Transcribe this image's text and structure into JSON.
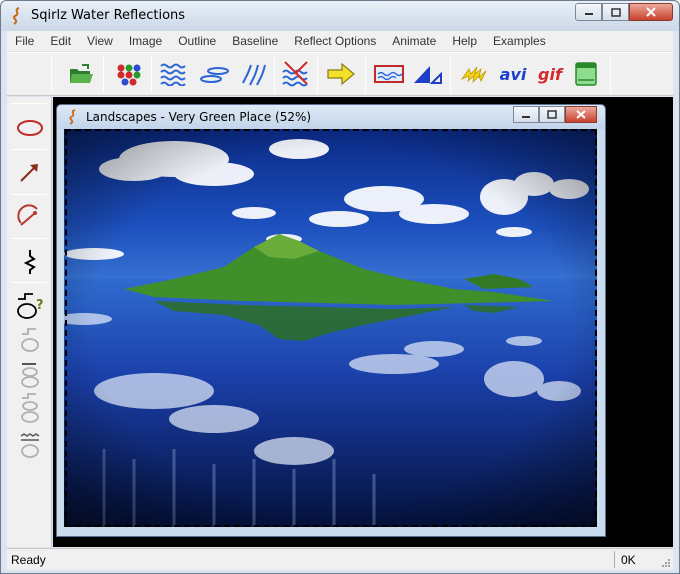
{
  "app": {
    "title": "Sqirlz Water Reflections",
    "logo_icon": "sqirlz-logo-icon"
  },
  "menu": [
    "File",
    "Edit",
    "View",
    "Image",
    "Outline",
    "Baseline",
    "Reflect Options",
    "Animate",
    "Help",
    "Examples"
  ],
  "toolbar": {
    "icons": [
      "open-folder-icon",
      "color-dots-icon",
      "wave-lines-icon",
      "ripple-ellipses-icon",
      "diagonal-waves-icon",
      "wave-cancel-icon",
      "arrow-right-icon",
      "reflect-frame-icon",
      "triangle-tool-icon",
      "lightning-icon"
    ],
    "avi_label": "avi",
    "gif_label": "gif",
    "last_icon": "panel-window-icon"
  },
  "leftbar": {
    "icons": [
      "ellipse-tool-icon",
      "arrow-tool-icon",
      "arc-tool-icon",
      "zigzag-line-icon",
      "shape-help-icon",
      "shape-step-1-icon",
      "shape-step-2-icon",
      "shape-step-3-icon",
      "shape-wave-icon"
    ],
    "help_glyph": "?"
  },
  "document": {
    "title": "Landscapes - Very Green Place  (52%)"
  },
  "status": {
    "text": "Ready",
    "right": "0K"
  },
  "colors": {
    "accent_blue": "#2b56c4",
    "sky": "#1a3fa8",
    "island_green": "#3f8f2a",
    "close_red": "#c8412d"
  }
}
